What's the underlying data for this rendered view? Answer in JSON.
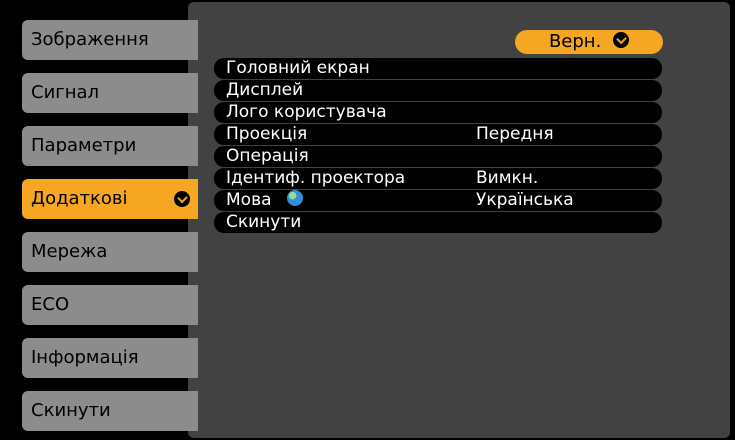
{
  "tabs": [
    {
      "label": "Зображення"
    },
    {
      "label": "Сигнал"
    },
    {
      "label": "Параметри"
    },
    {
      "label": "Додаткові",
      "active": true
    },
    {
      "label": "Мережа"
    },
    {
      "label": "ECO"
    },
    {
      "label": "Інформація"
    },
    {
      "label": "Скинути"
    }
  ],
  "back_button": {
    "label": "Верн."
  },
  "menu": [
    {
      "label": "Головний екран",
      "value": ""
    },
    {
      "label": "Дисплей",
      "value": ""
    },
    {
      "label": "Лого користувача",
      "value": ""
    },
    {
      "label": "Проекція",
      "value": "Передня"
    },
    {
      "label": "Операція",
      "value": ""
    },
    {
      "label": "Ідентиф. проектора",
      "value": "Вимкн."
    },
    {
      "label": "Мова",
      "value": "Українська",
      "icon": "globe-icon"
    },
    {
      "label": "Скинути",
      "value": ""
    }
  ],
  "colors": {
    "accent": "#f5a623",
    "tab": "#8c8c8c",
    "panel": "#424242",
    "row": "#000000"
  }
}
